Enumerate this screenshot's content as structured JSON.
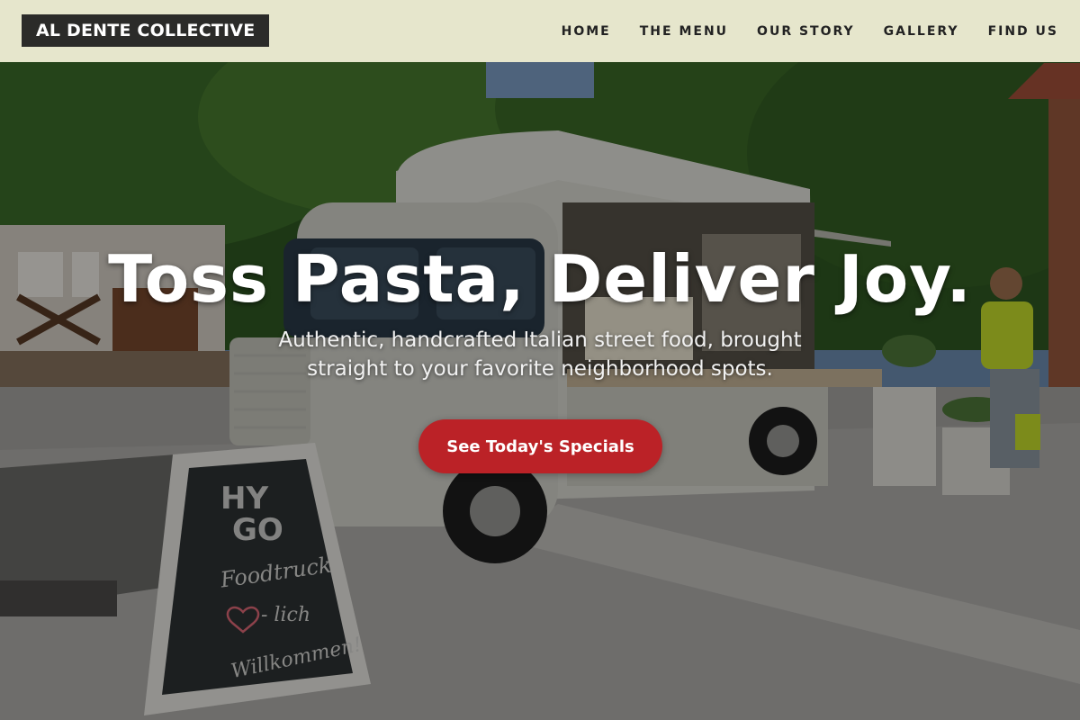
{
  "brand": {
    "name": "AL DENTE COLLECTIVE"
  },
  "nav": {
    "items": [
      {
        "label": "HOME"
      },
      {
        "label": "THE MENU"
      },
      {
        "label": "OUR STORY"
      },
      {
        "label": "GALLERY"
      },
      {
        "label": "FIND US"
      }
    ]
  },
  "hero": {
    "headline": "Toss Pasta, Deliver Joy.",
    "subheadline": "Authentic, handcrafted Italian street food, brought straight to your favorite neighborhood spots.",
    "cta_label": "See Today's Specials",
    "sign": {
      "line1": "HY",
      "line2": "GO",
      "line3": "Foodtruck",
      "line4": "- lich",
      "line5": "Willkommen!"
    }
  },
  "colors": {
    "header_bg": "#e6e6cc",
    "logo_bg": "#2b2b29",
    "cta_bg": "#bb2227"
  }
}
